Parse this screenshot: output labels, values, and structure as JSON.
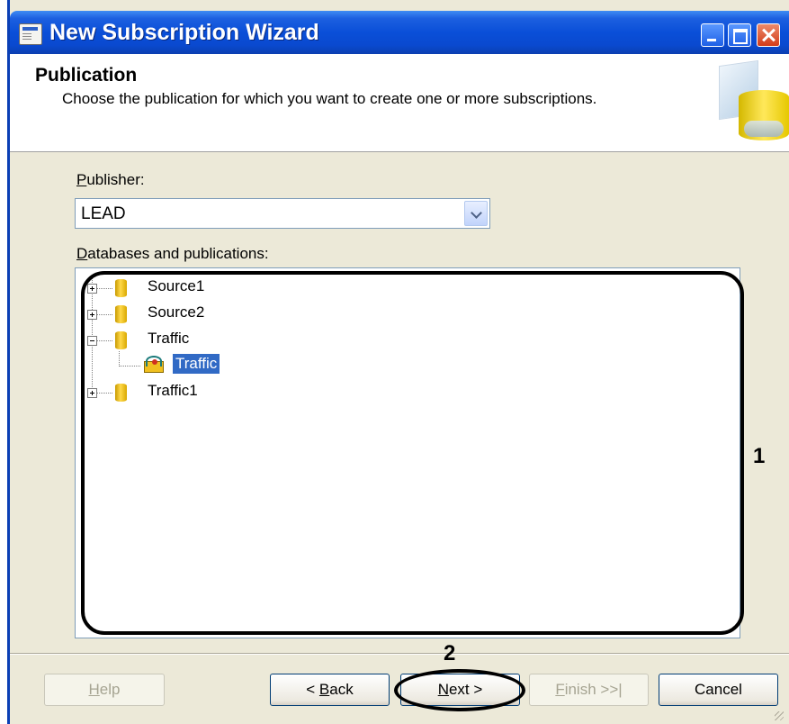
{
  "window": {
    "title": "New Subscription Wizard",
    "icon": "wizard-icon"
  },
  "header": {
    "title": "Publication",
    "description": "Choose the publication for which you want to create one or more subscriptions."
  },
  "publisher": {
    "label_prefix": "",
    "label_accel": "P",
    "label_rest": "ublisher:",
    "value": "LEAD"
  },
  "tree": {
    "label_accel": "D",
    "label_rest": "atabases and publications:",
    "items": [
      {
        "label": "Source1",
        "type": "database",
        "expanded": false
      },
      {
        "label": "Source2",
        "type": "database",
        "expanded": false
      },
      {
        "label": "Traffic",
        "type": "database",
        "expanded": true
      },
      {
        "label": "Traffic",
        "type": "publication",
        "selected": true
      },
      {
        "label": "Traffic1",
        "type": "database",
        "expanded": false
      }
    ]
  },
  "buttons": {
    "help_accel": "H",
    "help_rest": "elp",
    "back_pre": "< ",
    "back_accel": "B",
    "back_rest": "ack",
    "next_accel": "N",
    "next_rest": "ext >",
    "finish_accel": "F",
    "finish_rest": "inish >>|",
    "cancel": "Cancel"
  },
  "annotations": {
    "marker_1": "1",
    "marker_2": "2"
  },
  "colors": {
    "titlebar": "#0a4fd8",
    "selection": "#316ac5",
    "dialog_bg": "#ece9d8"
  }
}
